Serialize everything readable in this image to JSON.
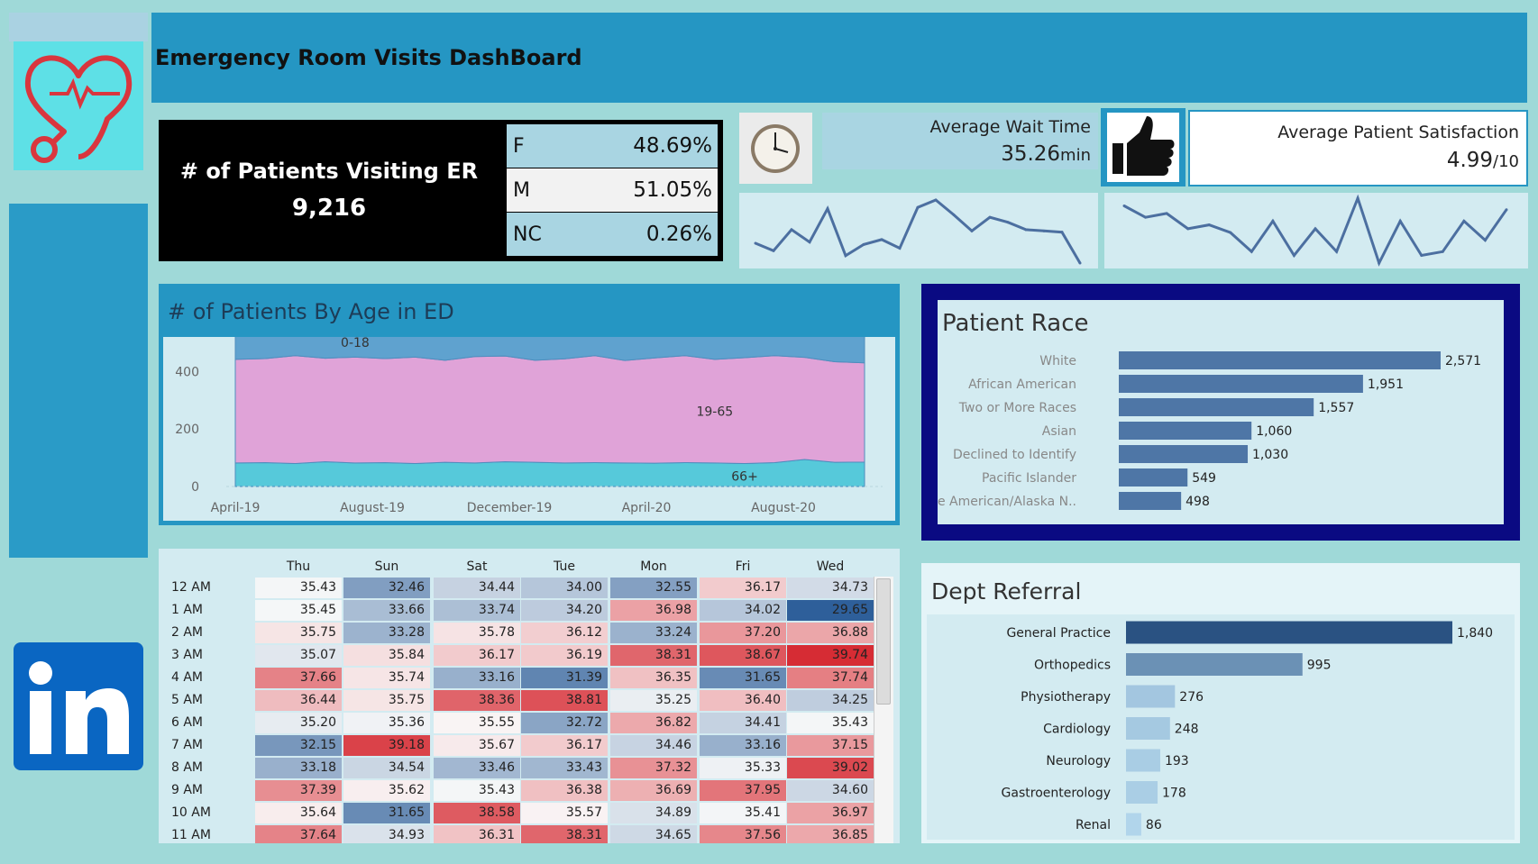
{
  "header": {
    "title": "Emergency Room Visits DashBoard"
  },
  "patients": {
    "label": "# of Patients Visiting ER",
    "value": "9,216",
    "gender": [
      {
        "code": "F",
        "pct": "48.69%"
      },
      {
        "code": "M",
        "pct": "51.05%"
      },
      {
        "code": "NC",
        "pct": "0.26%"
      }
    ]
  },
  "wait": {
    "label": "Average Wait Time",
    "value": "35.26",
    "unit": "min"
  },
  "satisfaction": {
    "label": "Average Patient Satisfaction",
    "value": "4.99",
    "unit": "/10"
  },
  "icons": {
    "logo": "heart-stethoscope-icon",
    "linkedin": "linkedin-icon",
    "clock": "clock-icon",
    "thumb": "thumbs-up-icon"
  },
  "colors": {
    "header": "#2596c3",
    "bar_dark": "#4e76a6",
    "band_0_18": "#5fa2cf",
    "band_19_65": "#e0a3d8",
    "band_66": "#56c9da",
    "spark": "#4c6fa0"
  },
  "chart_data": [
    {
      "type": "line",
      "id": "wait-sparkline",
      "title": "",
      "values": [
        33.8,
        33.2,
        34.9,
        33.9,
        36.6,
        32.8,
        33.7,
        34.1,
        33.4,
        36.7,
        37.3,
        36.1,
        34.8,
        35.9,
        35.5,
        34.9,
        34.8,
        34.7,
        32.2
      ]
    },
    {
      "type": "line",
      "id": "satisfaction-sparkline",
      "title": "",
      "values": [
        5.4,
        5.1,
        5.2,
        4.8,
        4.9,
        4.7,
        4.2,
        5.0,
        4.1,
        4.8,
        4.2,
        5.6,
        3.9,
        5.0,
        4.1,
        4.2,
        5.0,
        4.5,
        5.3
      ]
    },
    {
      "type": "area",
      "id": "age-area",
      "title": "# of Patients By Age in ED",
      "xlabel": "",
      "ylabel": "",
      "x_ticks": [
        "April-19",
        "August-19",
        "December-19",
        "April-20",
        "August-20"
      ],
      "y_ticks": [
        "0",
        "200",
        "400"
      ],
      "ylim": [
        0,
        520
      ],
      "stacked": true,
      "series": [
        {
          "name": "66+",
          "values": [
            82,
            83,
            80,
            86,
            82,
            83,
            80,
            84,
            82,
            86,
            84,
            82,
            83,
            82,
            81,
            83,
            82,
            80,
            83,
            94,
            84,
            85
          ]
        },
        {
          "name": "19-65",
          "values": [
            360,
            362,
            375,
            360,
            368,
            362,
            370,
            355,
            370,
            368,
            355,
            362,
            372,
            356,
            366,
            372,
            360,
            368,
            372,
            355,
            350,
            345
          ]
        },
        {
          "name": "0-18",
          "values": [
            106,
            107,
            105,
            106,
            104,
            105,
            108,
            106,
            106,
            107,
            111,
            104,
            104,
            110,
            105,
            103,
            108,
            107,
            107,
            115,
            99,
            104
          ]
        }
      ]
    },
    {
      "type": "bar",
      "id": "race-bar",
      "title": "Patient Race",
      "orientation": "horizontal",
      "categories": [
        "White",
        "African American",
        "Two or More Races",
        "Asian",
        "Declined to Identify",
        "Pacific Islander",
        "Native American/Alaska N.."
      ],
      "values": [
        2571,
        1951,
        1557,
        1060,
        1030,
        549,
        498
      ],
      "value_labels": [
        "2,571",
        "1,951",
        "1,557",
        "1,060",
        "1,030",
        "549",
        "498"
      ]
    },
    {
      "type": "heatmap",
      "id": "wait-heatmap",
      "title": "",
      "columns": [
        "Thu",
        "Sun",
        "Sat",
        "Tue",
        "Mon",
        "Fri",
        "Wed"
      ],
      "rows": [
        "12 AM",
        "1 AM",
        "2 AM",
        "3 AM",
        "4 AM",
        "5 AM",
        "6 AM",
        "7 AM",
        "8 AM",
        "9 AM",
        "10 AM",
        "11 AM"
      ],
      "values": [
        [
          35.43,
          32.46,
          34.44,
          34.0,
          32.55,
          36.17,
          34.73
        ],
        [
          35.45,
          33.66,
          33.74,
          34.2,
          36.98,
          34.02,
          29.65
        ],
        [
          35.75,
          33.28,
          35.78,
          36.12,
          33.24,
          37.2,
          36.88
        ],
        [
          35.07,
          35.84,
          36.17,
          36.19,
          38.31,
          38.67,
          39.74
        ],
        [
          37.66,
          35.74,
          33.16,
          31.39,
          36.35,
          31.65,
          37.74
        ],
        [
          36.44,
          35.75,
          38.36,
          38.81,
          35.25,
          36.4,
          34.25
        ],
        [
          35.2,
          35.36,
          35.55,
          32.72,
          36.82,
          34.41,
          35.43
        ],
        [
          32.15,
          39.18,
          35.67,
          36.17,
          34.46,
          33.16,
          37.15
        ],
        [
          33.18,
          34.54,
          33.46,
          33.43,
          37.32,
          35.33,
          39.02
        ],
        [
          37.39,
          35.62,
          35.43,
          36.38,
          36.69,
          37.95,
          34.6
        ],
        [
          35.64,
          31.65,
          38.58,
          35.57,
          34.89,
          35.41,
          36.97
        ],
        [
          37.64,
          34.93,
          36.31,
          38.31,
          34.65,
          37.56,
          36.85
        ]
      ]
    },
    {
      "type": "bar",
      "id": "dept-bar",
      "title": "Dept Referral",
      "orientation": "horizontal",
      "categories": [
        "General Practice",
        "Orthopedics",
        "Physiotherapy",
        "Cardiology",
        "Neurology",
        "Gastroenterology",
        "Renal"
      ],
      "values": [
        1840,
        995,
        276,
        248,
        193,
        178,
        86
      ],
      "value_labels": [
        "1,840",
        "995",
        "276",
        "248",
        "193",
        "178",
        "86"
      ]
    }
  ]
}
